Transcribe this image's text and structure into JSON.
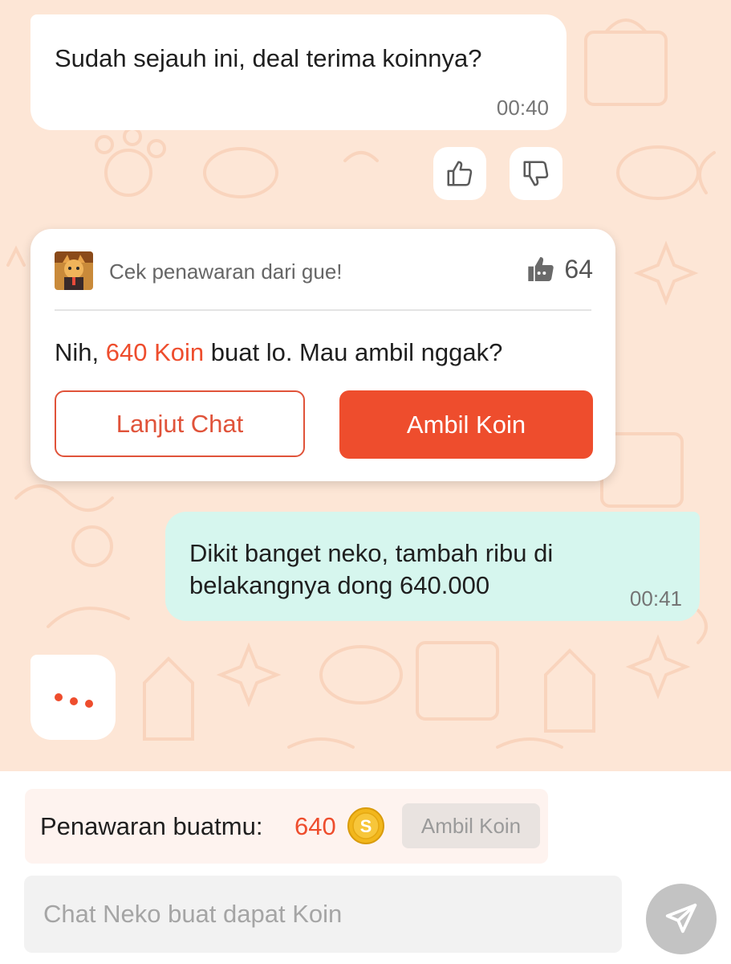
{
  "messages": {
    "bot1": {
      "text": "Sudah sejauh ini, deal terima koinnya?",
      "time": "00:40"
    },
    "user1": {
      "text": "Dikit banget neko, tambah ribu di belakangnya dong 640.000",
      "time": "00:41"
    }
  },
  "feedback": {
    "up_icon": "thumbs-up-icon",
    "down_icon": "thumbs-down-icon"
  },
  "offer_card": {
    "header": "Cek penawaran dari gue!",
    "likes": "64",
    "text_prefix": "Nih, ",
    "text_highlight": "640 Koin",
    "text_suffix": " buat lo. Mau ambil nggak?",
    "continue_label": "Lanjut Chat",
    "take_label": "Ambil Koin"
  },
  "offer_bar": {
    "label": "Penawaran buatmu:",
    "amount": "640",
    "button_label": "Ambil Koin",
    "coin_icon": "coin-icon"
  },
  "input": {
    "placeholder": "Chat Neko buat dapat Koin"
  },
  "colors": {
    "accent": "#ee4d2d",
    "bg": "#fde6d6",
    "user_bubble": "#d6f6ee"
  }
}
